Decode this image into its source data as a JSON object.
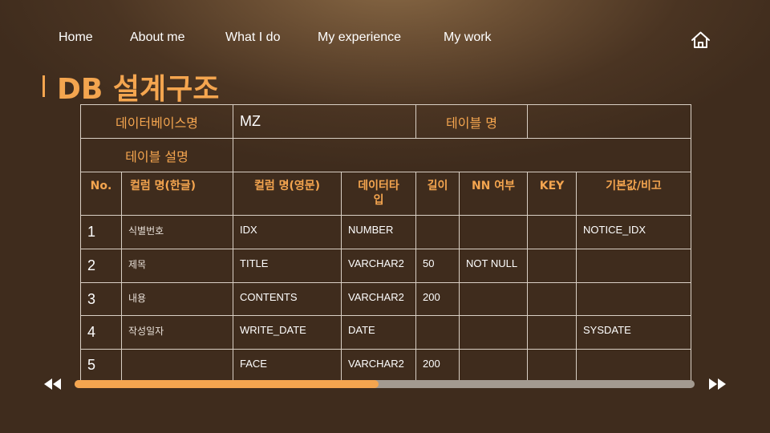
{
  "nav": {
    "items": [
      {
        "label": "Home"
      },
      {
        "label": "About me"
      },
      {
        "label": "What I do"
      },
      {
        "label": "My experience"
      },
      {
        "label": "My work"
      }
    ],
    "home_icon": "home-icon"
  },
  "title": "DB 설계구조",
  "table": {
    "db_label": "데이터베이스명",
    "db_value": "MZ",
    "table_name_label": "테이블 명",
    "table_name_value": "",
    "table_desc_label": "테이블 설명",
    "table_desc_value": "",
    "headers": [
      "No.",
      "컬럼 명(한글)",
      "컬럼 명(영문)",
      "데이터타\n입",
      "길이",
      "NN 여부",
      "KEY",
      "기본값/비고"
    ],
    "rows": [
      [
        "1",
        "식별번호",
        "IDX",
        "NUMBER",
        "",
        "",
        "",
        "NOTICE_IDX"
      ],
      [
        "2",
        "제목",
        "TITLE",
        "VARCHAR2",
        "50",
        "NOT NULL",
        "",
        ""
      ],
      [
        "3",
        "내용",
        "CONTENTS",
        "VARCHAR2",
        "200",
        "",
        "",
        ""
      ],
      [
        "4",
        "작성일자",
        "WRITE_DATE",
        "DATE",
        "",
        "",
        "",
        "SYSDATE"
      ],
      [
        "5",
        "",
        "FACE",
        "VARCHAR2",
        "200",
        "",
        "",
        ""
      ]
    ]
  },
  "scrollbar": {
    "progress_fraction": 0.49
  },
  "colors": {
    "accent": "#f4a54f",
    "background": "#3f2c1d",
    "track": "#a39a90"
  },
  "icons": {
    "prev": "rewind-icon",
    "next": "fast-forward-icon"
  }
}
